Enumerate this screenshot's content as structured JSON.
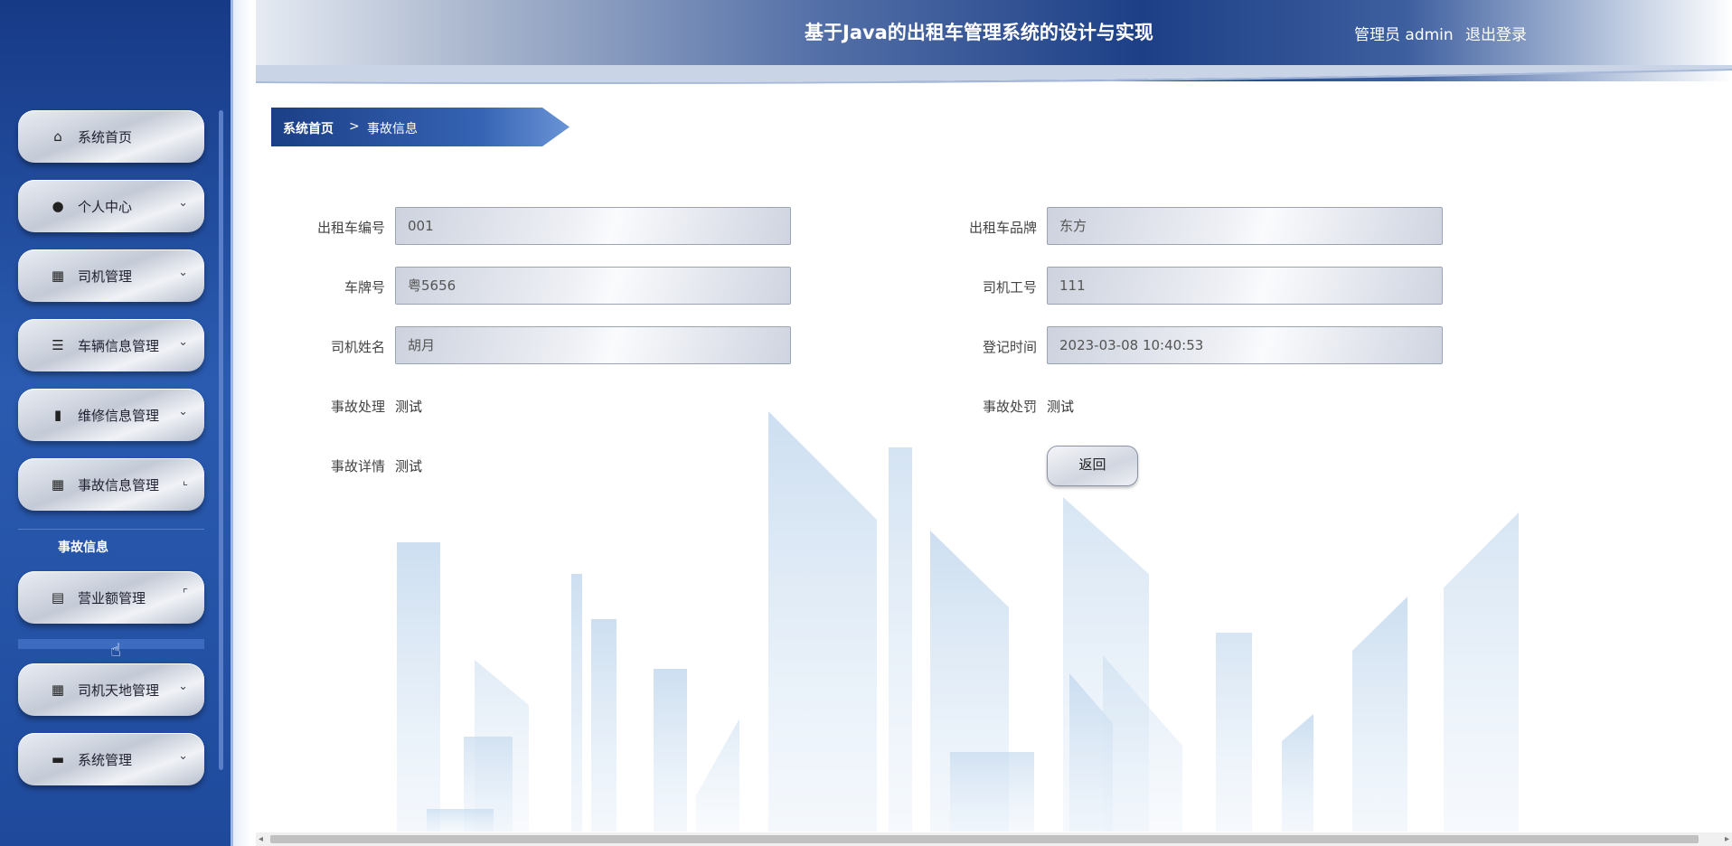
{
  "header": {
    "title": "基于Java的出租车管理系统的设计与实现",
    "user": "管理员 admin",
    "logout": "退出登录"
  },
  "sidebar": {
    "items": [
      {
        "label": "系统首页",
        "icon": "home-icon",
        "glyph": "⌂",
        "chevron": ""
      },
      {
        "label": "个人中心",
        "icon": "person-icon",
        "glyph": "●",
        "chevron": "⌄"
      },
      {
        "label": "司机管理",
        "icon": "grid-icon",
        "glyph": "▦",
        "chevron": "⌄"
      },
      {
        "label": "车辆信息管理",
        "icon": "sliders-icon",
        "glyph": "☰",
        "chevron": "⌄"
      },
      {
        "label": "维修信息管理",
        "icon": "book-icon",
        "glyph": "▮",
        "chevron": "⌄"
      },
      {
        "label": "事故信息管理",
        "icon": "grid-icon",
        "glyph": "▦",
        "chevron": "⌞"
      },
      {
        "label": "营业额管理",
        "icon": "clipboard-icon",
        "glyph": "▤",
        "chevron": "⌜"
      },
      {
        "label": "司机天地管理",
        "icon": "grid-icon",
        "glyph": "▦",
        "chevron": "⌄"
      },
      {
        "label": "系统管理",
        "icon": "briefcase-icon",
        "glyph": "▬",
        "chevron": "⌄"
      }
    ],
    "sub_item": "事故信息"
  },
  "breadcrumb": {
    "home": "系统首页",
    "separator": ">",
    "current": "事故信息"
  },
  "form": {
    "taxi_no": {
      "label": "出租车编号",
      "value": "001"
    },
    "taxi_brand": {
      "label": "出租车品牌",
      "value": "东方"
    },
    "plate": {
      "label": "车牌号",
      "value": "粤5656"
    },
    "driver_id": {
      "label": "司机工号",
      "value": "111"
    },
    "driver_name": {
      "label": "司机姓名",
      "value": "胡月"
    },
    "reg_time": {
      "label": "登记时间",
      "value": "2023-03-08 10:40:53"
    },
    "handling": {
      "label": "事故处理",
      "value": "测试"
    },
    "penalty": {
      "label": "事故处罚",
      "value": "测试"
    },
    "details": {
      "label": "事故详情",
      "value": "测试"
    },
    "back_button": "返回"
  }
}
